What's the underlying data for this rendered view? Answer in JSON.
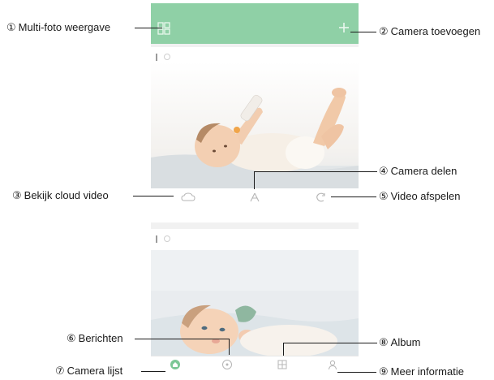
{
  "callouts": {
    "c1": {
      "num": "①",
      "text": "Multi-foto weergave"
    },
    "c2": {
      "num": "②",
      "text": "Camera toevoegen"
    },
    "c3": {
      "num": "③",
      "text": "Bekijk cloud video"
    },
    "c4": {
      "num": "④",
      "text": "Camera delen"
    },
    "c5": {
      "num": "⑤",
      "text": "Video afspelen"
    },
    "c6": {
      "num": "⑥",
      "text": "Berichten"
    },
    "c7": {
      "num": "⑦",
      "text": "Camera lijst"
    },
    "c8": {
      "num": "⑧",
      "text": "Album"
    },
    "c9": {
      "num": "⑨",
      "text": "Meer informatie"
    }
  },
  "colors": {
    "accent": "#8fd0a6",
    "tab_active": "#7cc796",
    "icon_gray": "#b5b5b5"
  },
  "icons": {
    "multi_photo": "grid-icon",
    "add_camera": "plus-icon",
    "cloud_video": "cloud-icon",
    "share": "share-icon",
    "playback": "playback-icon",
    "camera_list": "home-icon",
    "messages": "message-icon",
    "album": "album-icon",
    "more": "person-icon"
  }
}
